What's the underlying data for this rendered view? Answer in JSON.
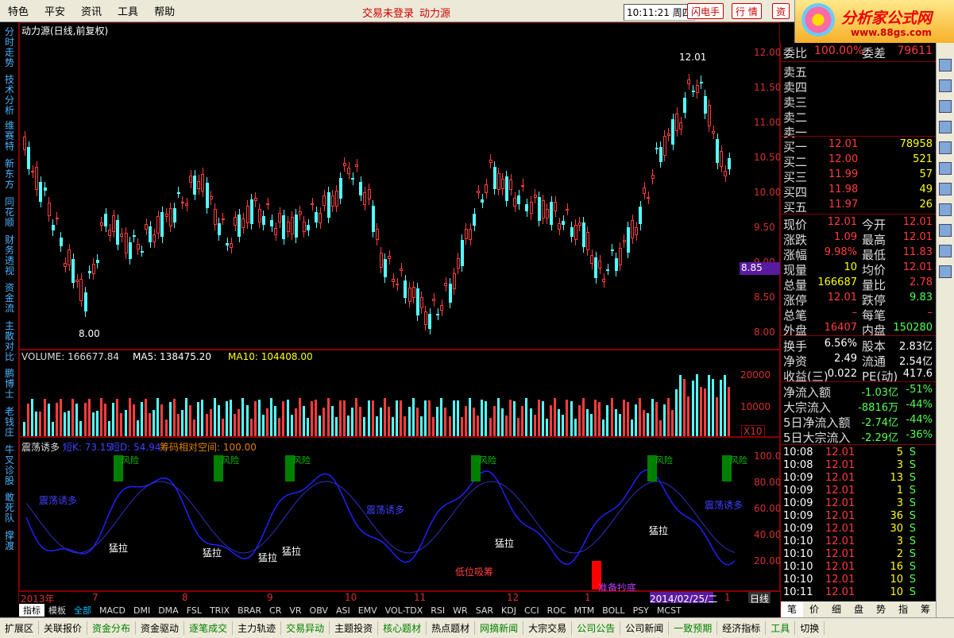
{
  "menu": {
    "items": [
      "特色",
      "平安",
      "资讯",
      "工具",
      "帮助"
    ],
    "status_login": "交易未登录",
    "stock_name": "动力源",
    "clock": "10:11:21 周四",
    "btn_flash": "闪电手",
    "btn_quote": "行 情",
    "btn_info": "资"
  },
  "logo": {
    "title": "分析家公式网",
    "url": "www.88gs.com"
  },
  "left_tabs": [
    "分时走势",
    "技术分析",
    "维赛特",
    "新东方",
    "同花顺",
    "财务透视",
    "资金流",
    "主散对比",
    "鹏博士",
    "老钱庄",
    "牛叉诊股",
    "敢死队",
    "撑渡"
  ],
  "price_chart": {
    "title": "动力源(日线,前复权)",
    "yticks": [
      "12.00",
      "11.50",
      "11.00",
      "10.50",
      "10.00",
      "9.50",
      "9.00",
      "8.50",
      "8.00"
    ],
    "current_price_tag": "8.85",
    "high_label": "12.01",
    "low_label": "8.00"
  },
  "volume_chart": {
    "label_volume": "VOLUME: 166677.84",
    "label_ma5": "MA5: 138475.20",
    "label_ma10": "MA10: 104408.00",
    "yticks": [
      "20000",
      "10000"
    ],
    "unit": "X10"
  },
  "indicator_chart": {
    "name": "震荡诱多",
    "label_k": "短K: 73.15",
    "label_d": "短D: 54.94",
    "label_space": "筹码相对空间: 100.00",
    "yticks": [
      "100.00",
      "80.00",
      "60.00",
      "40.00",
      "20.00"
    ],
    "signal": "风险",
    "annotations": [
      "震荡诱多",
      "猛拉",
      "猛拉",
      "猛拉",
      "猛拉",
      "震荡诱多",
      "低位吸筹",
      "猛拉",
      "准备抄底",
      "猛拉",
      "震荡诱多"
    ]
  },
  "time_axis": {
    "labels": [
      "2013年",
      "7",
      "8",
      "9",
      "10",
      "11",
      "12",
      "1",
      "1"
    ],
    "cursor_date": "2014/02/25/二",
    "period": "日线"
  },
  "indicators": [
    "指标",
    "模板",
    "全部",
    "MACD",
    "DMI",
    "DMA",
    "FSL",
    "TRIX",
    "BRAR",
    "CR",
    "VR",
    "OBV",
    "ASI",
    "EMV",
    "VOL-TDX",
    "RSI",
    "WR",
    "SAR",
    "KDJ",
    "CCI",
    "ROC",
    "MTM",
    "BOLL",
    "PSY",
    "MCST"
  ],
  "module_tabs": [
    "扩展区",
    "关联报价",
    "资金分布",
    "资金驱动",
    "逐笔成交",
    "主力轨迹",
    "交易异动",
    "主题投资",
    "核心题材",
    "热点题材",
    "网摘新闻",
    "大宗交易",
    "公司公告",
    "公司新闻",
    "一致预期",
    "经济指标",
    "工具",
    "切换"
  ],
  "quote": {
    "weibi_label": "委比",
    "weibi": "100.00%",
    "weicha_label": "委差",
    "weicha": "79611",
    "sell": [
      {
        "label": "卖五"
      },
      {
        "label": "卖四"
      },
      {
        "label": "卖三"
      },
      {
        "label": "卖二"
      },
      {
        "label": "卖一"
      }
    ],
    "buy": [
      {
        "label": "买一",
        "price": "12.01",
        "vol": "78958"
      },
      {
        "label": "买二",
        "price": "12.00",
        "vol": "521"
      },
      {
        "label": "买三",
        "price": "11.99",
        "vol": "57"
      },
      {
        "label": "买四",
        "price": "11.98",
        "vol": "49"
      },
      {
        "label": "买五",
        "price": "11.97",
        "vol": "26"
      }
    ],
    "stats": [
      {
        "l1": "现价",
        "v1": "12.01",
        "l2": "今开",
        "v2": "12.01"
      },
      {
        "l1": "涨跌",
        "v1": "1.09",
        "l2": "最高",
        "v2": "12.01"
      },
      {
        "l1": "涨幅",
        "v1": "9.98%",
        "l2": "最低",
        "v2": "11.83"
      },
      {
        "l1": "现量",
        "v1": "10",
        "l2": "均价",
        "v2": "12.01"
      },
      {
        "l1": "总量",
        "v1": "166687",
        "l2": "量比",
        "v2": "2.78"
      },
      {
        "l1": "涨停",
        "v1": "12.01",
        "l2": "跌停",
        "v2": "9.83"
      },
      {
        "l1": "总笔",
        "v1": "–",
        "l2": "每笔",
        "v2": "–"
      },
      {
        "l1": "外盘",
        "v1": "16407",
        "l2": "内盘",
        "v2": "150280"
      }
    ],
    "fundamentals": [
      {
        "l1": "换手",
        "v1": "6.56%",
        "l2": "股本",
        "v2": "2.83亿"
      },
      {
        "l1": "净资",
        "v1": "2.49",
        "l2": "流通",
        "v2": "2.54亿"
      },
      {
        "l1": "收益(三)",
        "v1": "0.022",
        "l2": "PE(动)",
        "v2": "417.6"
      }
    ],
    "flows": [
      {
        "label": "净流入额",
        "val": "-1.03亿",
        "pct": "-51%"
      },
      {
        "label": "大宗流入",
        "val": "-8816万",
        "pct": "-44%"
      },
      {
        "label": "5日净流入额",
        "val": "-2.74亿",
        "pct": "-44%"
      },
      {
        "label": "5日大宗流入",
        "val": "-2.29亿",
        "pct": "-36%"
      }
    ],
    "ticks": [
      {
        "t": "10:08",
        "p": "12.01",
        "v": "5",
        "s": "S"
      },
      {
        "t": "10:08",
        "p": "12.01",
        "v": "3",
        "s": "S"
      },
      {
        "t": "10:09",
        "p": "12.01",
        "v": "13",
        "s": "S"
      },
      {
        "t": "10:09",
        "p": "12.01",
        "v": "1",
        "s": "S"
      },
      {
        "t": "10:09",
        "p": "12.01",
        "v": "3",
        "s": "S"
      },
      {
        "t": "10:09",
        "p": "12.01",
        "v": "36",
        "s": "S"
      },
      {
        "t": "10:09",
        "p": "12.01",
        "v": "30",
        "s": "S"
      },
      {
        "t": "10:10",
        "p": "12.01",
        "v": "3",
        "s": "S"
      },
      {
        "t": "10:10",
        "p": "12.01",
        "v": "2",
        "s": "S"
      },
      {
        "t": "10:10",
        "p": "12.01",
        "v": "16",
        "s": "S"
      },
      {
        "t": "10:10",
        "p": "12.01",
        "v": "10",
        "s": "S"
      },
      {
        "t": "10:11",
        "p": "12.01",
        "v": "10",
        "s": "S"
      }
    ],
    "bottom_tabs": [
      "笔",
      "价",
      "细",
      "盘",
      "势",
      "指",
      "筹"
    ]
  },
  "right_icons": [
    "dot",
    "bars",
    "line",
    "cs",
    "fi",
    "kn",
    "wr",
    "rsi",
    "x",
    "plus",
    "sq"
  ],
  "colors": {
    "up": "#ff3c3c",
    "down": "#54ffff",
    "ma_white": "#ffffff",
    "ma_yellow": "#ffff00",
    "accent": "#800000"
  }
}
